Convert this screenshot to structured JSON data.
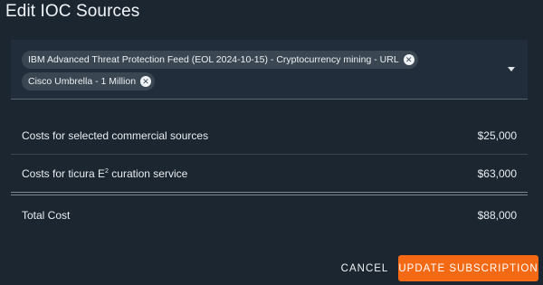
{
  "dialog": {
    "title": "Edit IOC Sources"
  },
  "sources_select": {
    "chips": [
      {
        "label": "IBM Advanced Threat Protection Feed (EOL 2024-10-15) - Cryptocurrency mining - URL",
        "remove_icon": "close-circle-icon"
      },
      {
        "label": "Cisco Umbrella - 1 Million",
        "remove_icon": "close-circle-icon"
      }
    ],
    "dropdown_icon": "caret-down-icon"
  },
  "costs": {
    "commercial": {
      "label": "Costs for selected commercial sources",
      "value": "$25,000"
    },
    "curation": {
      "label_prefix": "Costs for ticura E",
      "label_sup": "2",
      "label_suffix": " curation service",
      "value": "$63,000"
    },
    "total": {
      "label": "Total Cost",
      "value": "$88,000"
    }
  },
  "actions": {
    "cancel": "CANCEL",
    "update": "UPDATE SUBSCRIPTION"
  },
  "colors": {
    "background": "#1b2631",
    "accent": "#f46a14",
    "chip": "#3a4651"
  }
}
